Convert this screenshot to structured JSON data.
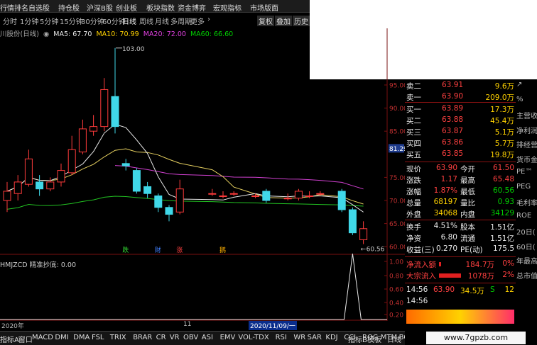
{
  "top_menu": [
    "行情排名",
    "自选股",
    "持仓股",
    "沪深B股",
    "创业板",
    "板块指数",
    "资金博弈",
    "宏观指标",
    "市场版面"
  ],
  "period_tabs": [
    "分时",
    "1分钟",
    "5分钟",
    "15分钟",
    "30分钟",
    "60分钟",
    "日线",
    "周线",
    "月线",
    "多周期",
    "更多"
  ],
  "period_more_arrow": "›",
  "right_buttons": [
    "复权",
    "叠加",
    "历史"
  ],
  "stock_title": "川股份(日线)",
  "ma": {
    "ma5": "MA5: 67.70",
    "ma10": "MA10: 70.99",
    "ma20": "MA20: 72.00",
    "ma60": "MA60: 66.60"
  },
  "indicator_label": "HMJZCD  精准抄底: 0.00",
  "date_labels": [
    "2020年",
    "11",
    "2020/11/09/一"
  ],
  "bottom_tabs": [
    "指标A",
    "窗口",
    "MACD",
    "DMI",
    "DMA",
    "FSL",
    "TRIX",
    "BRAR",
    "CR",
    "VR",
    "OBV",
    "ASI",
    "EMV",
    "VOL-TDX",
    "RSI",
    "WR",
    "SAR",
    "KDJ",
    "CCI",
    "ROC",
    "MTM",
    "BOLL"
  ],
  "bottom_right_tabs": [
    "指标B",
    "模板",
    "日线"
  ],
  "quote": {
    "orders": [
      {
        "label": "卖二",
        "price": "63.91",
        "vol": "9.6万"
      },
      {
        "label": "卖一",
        "price": "63.90",
        "vol": "209.0万"
      },
      {
        "label": "买一",
        "price": "63.89",
        "vol": "17.3万"
      },
      {
        "label": "买二",
        "price": "63.88",
        "vol": "45.4万"
      },
      {
        "label": "买三",
        "price": "63.87",
        "vol": "5.1万"
      },
      {
        "label": "买四",
        "price": "63.86",
        "vol": "5.7万"
      },
      {
        "label": "买五",
        "price": "63.85",
        "vol": "19.8万"
      }
    ],
    "stats": [
      {
        "l1": "现价",
        "v1": "63.90",
        "l2": "今开",
        "v2": "61.50"
      },
      {
        "l1": "涨跌",
        "v1": "1.17",
        "l2": "最高",
        "v2": "65.48"
      },
      {
        "l1": "涨幅",
        "v1": "1.87%",
        "l2": "最低",
        "v2": "60.56"
      },
      {
        "l1": "总量",
        "v1": "68197",
        "l2": "量比",
        "v2": "0.93"
      },
      {
        "l1": "外盘",
        "v1": "34068",
        "l2": "内盘",
        "v2": "34129"
      },
      {
        "l1": "换手",
        "v1": "4.51%",
        "l2": "股本",
        "v2": "1.51亿"
      },
      {
        "l1": "净资",
        "v1": "6.80",
        "l2": "流通",
        "v2": "1.51亿"
      },
      {
        "l1": "收益(三)",
        "v1": "0.270",
        "l2": "PE(动)",
        "v2": "175.5"
      }
    ],
    "flows": [
      {
        "label": "净流入额",
        "value": "184.7万",
        "pct": "0%",
        "bar": 0.08
      },
      {
        "label": "大宗流入",
        "value": "1078万",
        "pct": "2%",
        "bar": 0.9
      }
    ],
    "ticks": [
      {
        "time": "14:56",
        "price": "63.90",
        "vol": "34.5万",
        "flag": "S",
        "num": "12"
      },
      {
        "time": "14:56",
        "price": "",
        "vol": "",
        "flag": "",
        "num": ""
      }
    ]
  },
  "sidebar_items": [
    "↗",
    "%",
    "主营收",
    "净利润",
    "排经营",
    "货币金",
    "PE™",
    "PEG",
    "毛利率",
    "ROE",
    "20日(",
    "60日(",
    "年最高",
    "总市值"
  ],
  "watermark": "www.7gpzb.com",
  "price_axis": [
    "95.00",
    "90.00",
    "85.00",
    "81.29",
    "75.00",
    "70.00",
    "65.00",
    "60.00"
  ],
  "ind_axis": [
    "1.00",
    "0.80",
    "0.60",
    "0.40",
    "0.20"
  ],
  "chart_data": {
    "type": "candlestick",
    "ylim": [
      58.5,
      104.5
    ],
    "candles": [
      {
        "o": 70.0,
        "c": 72.0,
        "h": 74.0,
        "l": 67.5
      },
      {
        "o": 71.5,
        "c": 74.0,
        "h": 75.5,
        "l": 70.0
      },
      {
        "o": 73.5,
        "c": 79.0,
        "h": 81.0,
        "l": 73.0
      },
      {
        "o": 74.0,
        "c": 72.5,
        "h": 75.5,
        "l": 71.0
      },
      {
        "o": 72.5,
        "c": 74.0,
        "h": 75.0,
        "l": 72.0
      },
      {
        "o": 74.0,
        "c": 76.5,
        "h": 78.0,
        "l": 73.0
      },
      {
        "o": 76.0,
        "c": 81.0,
        "h": 84.0,
        "l": 75.5
      },
      {
        "o": 80.5,
        "c": 85.5,
        "h": 87.5,
        "l": 80.0
      },
      {
        "o": 85.0,
        "c": 86.0,
        "h": 88.5,
        "l": 84.0
      },
      {
        "o": 86.0,
        "c": 94.0,
        "h": 96.5,
        "l": 85.0
      },
      {
        "o": 92.5,
        "c": 86.0,
        "h": 103.0,
        "l": 84.5
      },
      {
        "o": 78.0,
        "c": 77.5,
        "h": 79.0,
        "l": 76.5
      },
      {
        "o": 76.5,
        "c": 72.0,
        "h": 77.0,
        "l": 71.5
      },
      {
        "o": 73.0,
        "c": 71.5,
        "h": 74.0,
        "l": 70.5
      },
      {
        "o": 71.0,
        "c": 68.5,
        "h": 71.5,
        "l": 67.5
      },
      {
        "o": 68.5,
        "c": 67.0,
        "h": 69.0,
        "l": 65.5
      },
      {
        "o": 67.5,
        "c": 72.5,
        "h": 74.5,
        "l": 67.0
      },
      {
        "o": 71.5,
        "c": 71.5,
        "h": 72.5,
        "l": 71.0
      },
      {
        "o": 71.0,
        "c": 71.0,
        "h": 72.0,
        "l": 70.5
      },
      {
        "o": 71.5,
        "c": 71.5,
        "h": 72.0,
        "l": 71.0
      },
      {
        "o": 71.0,
        "c": 71.0,
        "h": 71.5,
        "l": 70.5
      },
      {
        "o": 72.0,
        "c": 70.0,
        "h": 72.5,
        "l": 69.5
      },
      {
        "o": 70.5,
        "c": 70.5,
        "h": 71.5,
        "l": 70.0
      },
      {
        "o": 70.5,
        "c": 72.0,
        "h": 72.5,
        "l": 70.0
      },
      {
        "o": 71.0,
        "c": 71.0,
        "h": 72.0,
        "l": 70.5
      },
      {
        "o": 71.5,
        "c": 71.5,
        "h": 72.0,
        "l": 71.0
      },
      {
        "o": 72.0,
        "c": 68.0,
        "h": 72.5,
        "l": 67.5
      },
      {
        "o": 68.0,
        "c": 63.0,
        "h": 68.5,
        "l": 62.5
      },
      {
        "o": 61.5,
        "c": 63.9,
        "h": 65.5,
        "l": 60.56
      }
    ],
    "candle_slots": [
      0,
      1,
      2,
      3,
      4,
      5,
      6,
      7,
      8,
      9,
      10,
      11,
      12,
      13,
      14,
      15,
      16,
      19,
      20,
      21,
      23,
      24,
      26,
      27,
      28,
      29,
      31,
      32,
      33
    ],
    "signal_labels": [
      "跌",
      "财",
      "涨",
      "鹅"
    ],
    "signal_slots": [
      11,
      14,
      16,
      20
    ],
    "annotations": [
      "103.00",
      "60.56"
    ],
    "indicator": {
      "name": "精准抄底",
      "value": "0.00",
      "spike_at": 32
    }
  }
}
